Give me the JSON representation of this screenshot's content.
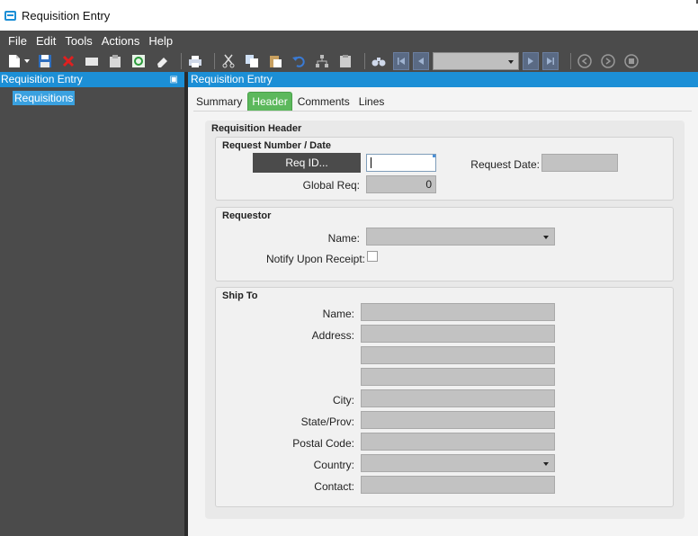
{
  "window": {
    "title": "Requisition Entry"
  },
  "menu": [
    "File",
    "Edit",
    "Tools",
    "Actions",
    "Help"
  ],
  "toolbar": {
    "icons": [
      "new-icon",
      "save-icon",
      "delete-icon",
      "clear-icon",
      "copy-doc-icon",
      "refresh-icon",
      "eraser-icon",
      "print-icon",
      "cut-icon",
      "copy-icon",
      "paste-icon",
      "undo-icon",
      "hierarchy-icon",
      "clipboard-icon",
      "find-icon",
      "first-record-icon",
      "prev-record-icon",
      "next-record-icon",
      "last-record-icon",
      "back-icon",
      "forward-icon",
      "stop-icon"
    ],
    "record_selector": ""
  },
  "left_pane": {
    "header": "Requisition Entry",
    "tree": [
      {
        "label": "Requisitions",
        "selected": true
      }
    ]
  },
  "right_pane": {
    "header": "Requisition Entry",
    "tabs": [
      {
        "label": "Summary",
        "active": false
      },
      {
        "label": "Header",
        "active": true
      },
      {
        "label": "Comments",
        "active": false
      },
      {
        "label": "Lines",
        "active": false
      }
    ]
  },
  "form": {
    "section_title": "Requisition Header",
    "request": {
      "title": "Request Number / Date",
      "req_id_button": "Req ID...",
      "req_id_value": "",
      "request_date_label": "Request Date:",
      "request_date_value": "",
      "global_req_label": "Global Req:",
      "global_req_value": "0"
    },
    "requestor": {
      "title": "Requestor",
      "name_label": "Name:",
      "name_value": "",
      "notify_label": "Notify Upon Receipt:",
      "notify_checked": false
    },
    "ship_to": {
      "title": "Ship To",
      "name_label": "Name:",
      "address_label": "Address:",
      "city_label": "City:",
      "state_label": "State/Prov:",
      "postal_label": "Postal Code:",
      "country_label": "Country:",
      "contact_label": "Contact:",
      "name_value": "",
      "address_lines": [
        "",
        "",
        ""
      ],
      "city_value": "",
      "state_value": "",
      "postal_value": "",
      "country_value": "",
      "contact_value": ""
    }
  },
  "colors": {
    "header_blue": "#1c8fd6",
    "active_tab_green": "#5cb85c",
    "chrome_dark": "#4b4b4b",
    "field_gray": "#c2c2c2"
  }
}
